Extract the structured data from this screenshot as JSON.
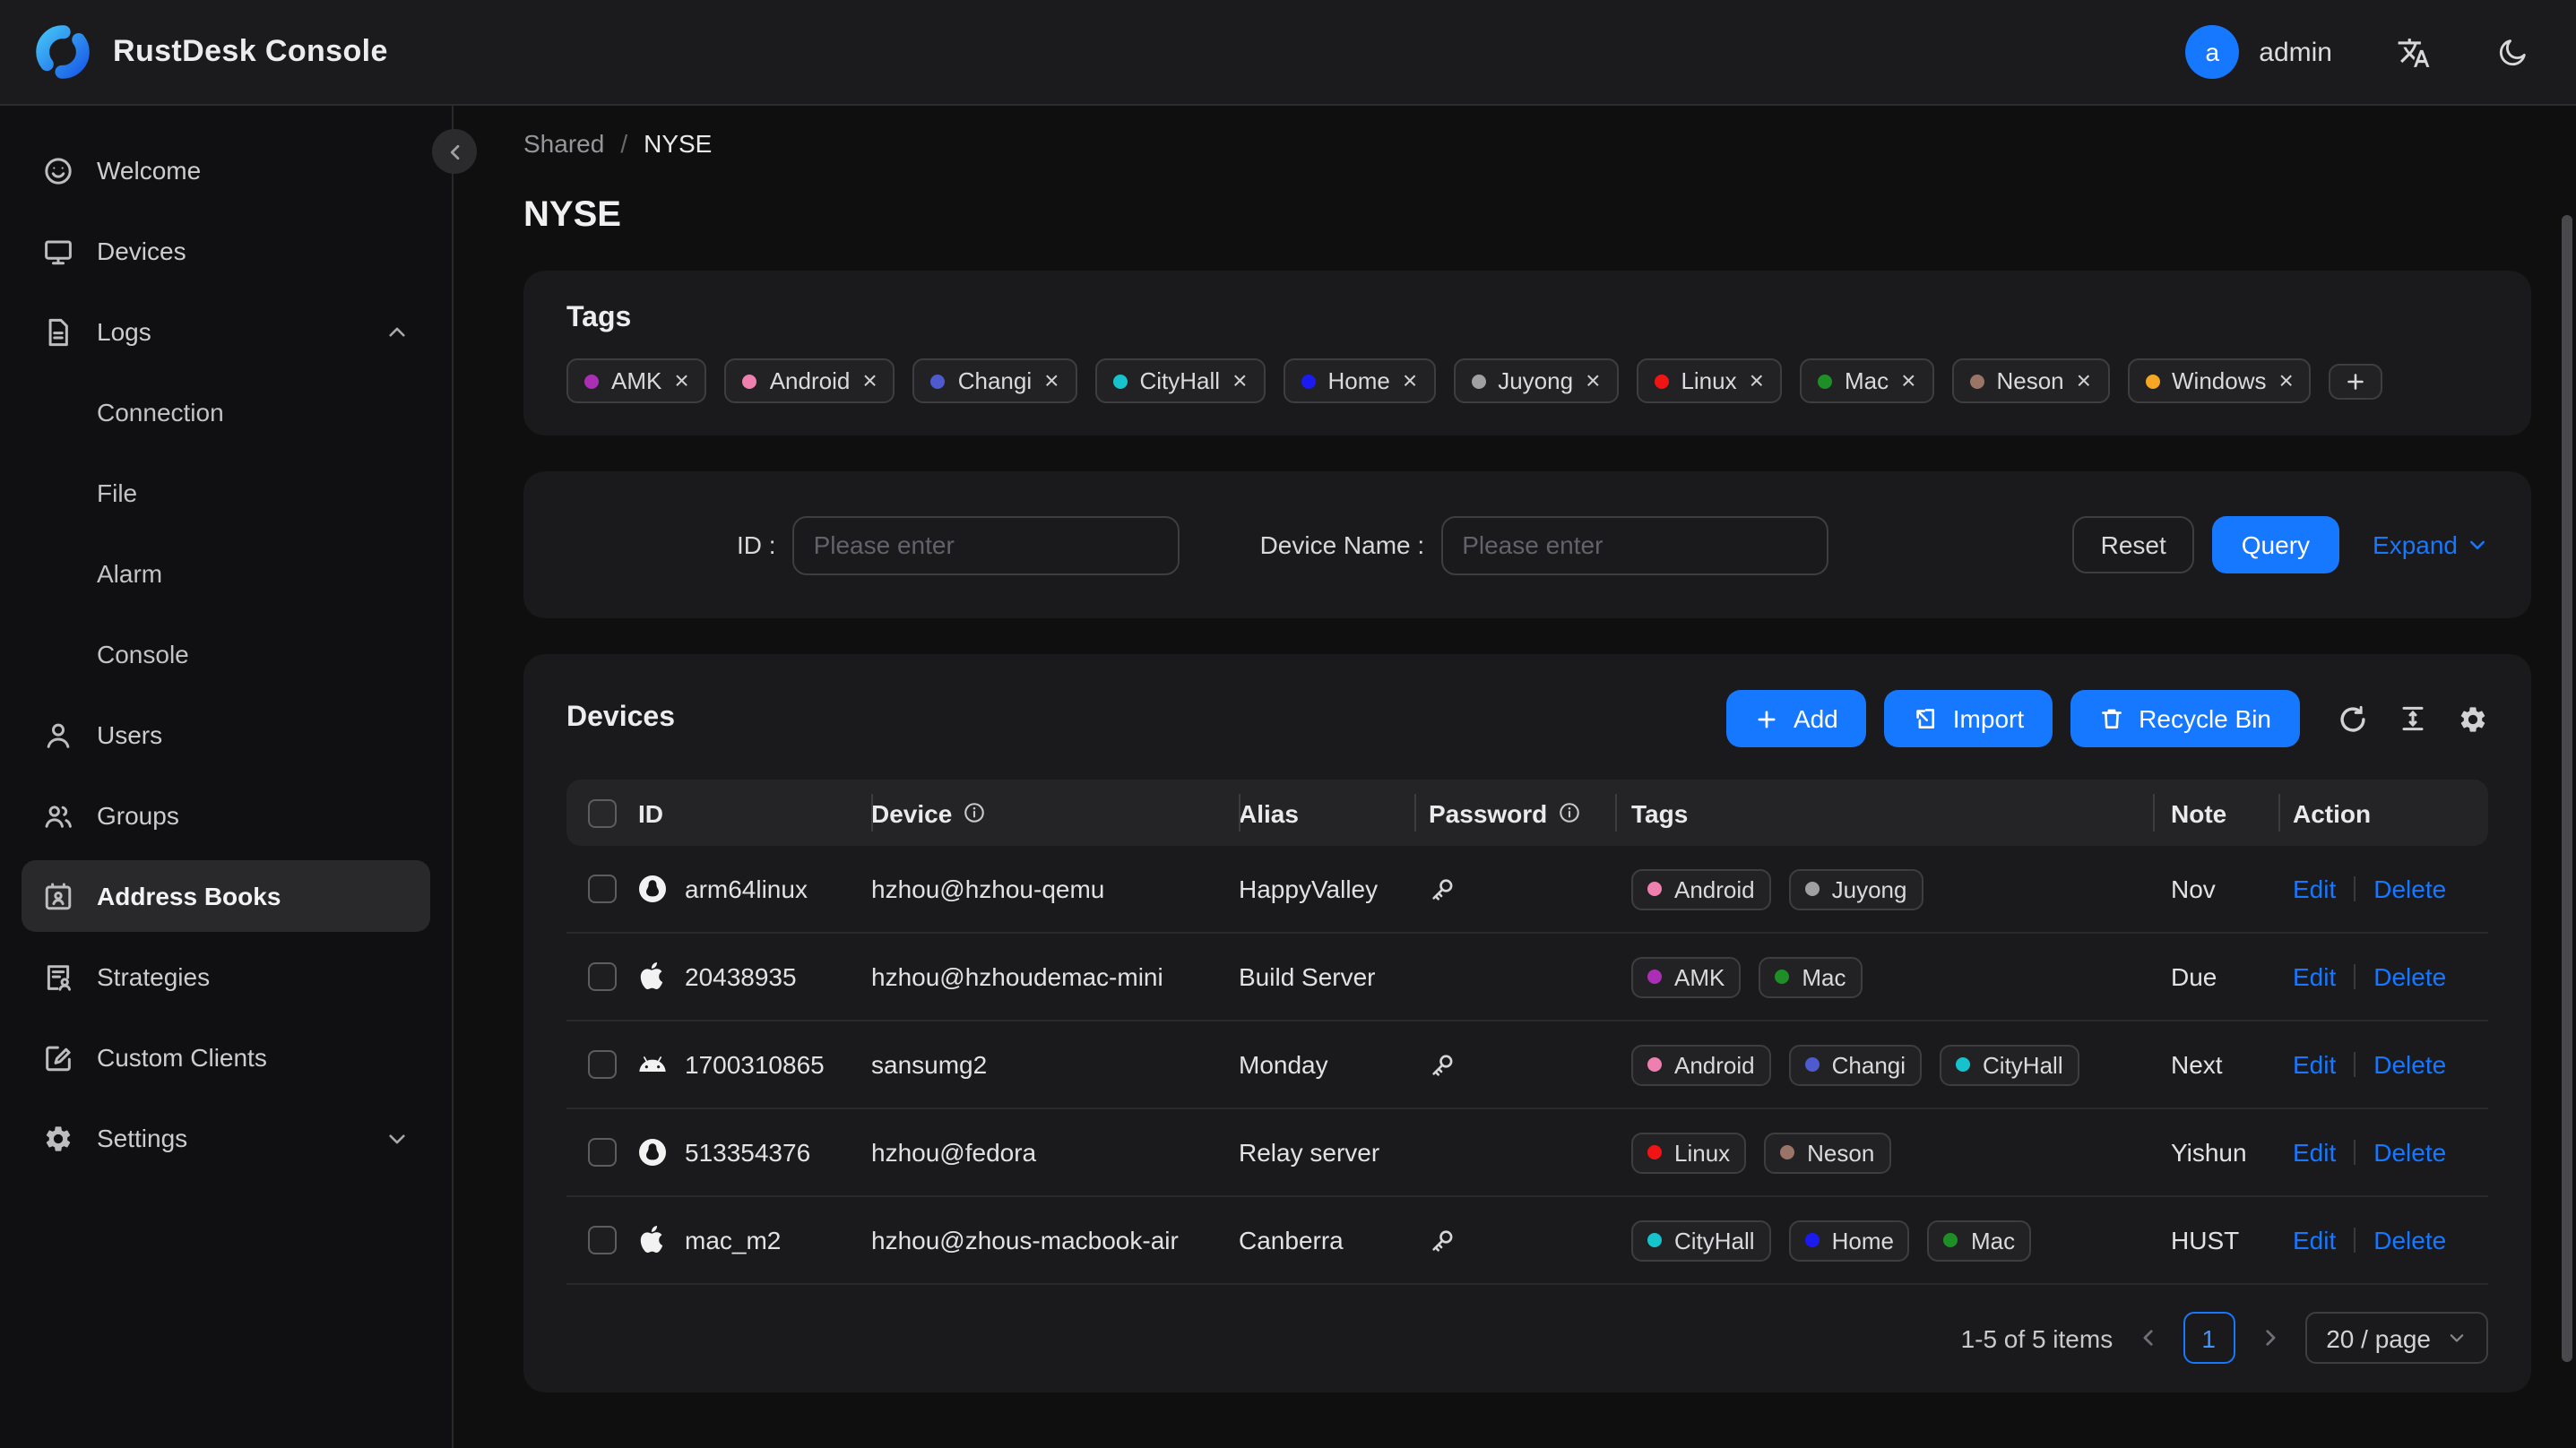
{
  "header": {
    "title": "RustDesk Console",
    "user": {
      "initial": "a",
      "name": "admin"
    }
  },
  "sidebar": {
    "items": [
      {
        "label": "Welcome",
        "icon": "smiley-icon"
      },
      {
        "label": "Devices",
        "icon": "monitor-icon"
      },
      {
        "label": "Logs",
        "icon": "document-icon",
        "expanded": true,
        "children": [
          "Connection",
          "File",
          "Alarm",
          "Console"
        ]
      },
      {
        "label": "Users",
        "icon": "user-icon"
      },
      {
        "label": "Groups",
        "icon": "group-icon"
      },
      {
        "label": "Address Books",
        "icon": "address-book-icon",
        "active": true
      },
      {
        "label": "Strategies",
        "icon": "strategy-icon"
      },
      {
        "label": "Custom Clients",
        "icon": "edit-square-icon"
      },
      {
        "label": "Settings",
        "icon": "gear-icon",
        "collapsed": true
      }
    ]
  },
  "breadcrumb": {
    "parent": "Shared",
    "current": "NYSE"
  },
  "page_title": "NYSE",
  "tags_card": {
    "title": "Tags",
    "tags": [
      {
        "name": "AMK",
        "color": "#ab2fb5"
      },
      {
        "name": "Android",
        "color": "#ef7fae"
      },
      {
        "name": "Changi",
        "color": "#4d5bce"
      },
      {
        "name": "CityHall",
        "color": "#16c2cc"
      },
      {
        "name": "Home",
        "color": "#1b1bf0"
      },
      {
        "name": "Juyong",
        "color": "#a0a0a2"
      },
      {
        "name": "Linux",
        "color": "#f01414"
      },
      {
        "name": "Mac",
        "color": "#1d8f26"
      },
      {
        "name": "Neson",
        "color": "#9b7468"
      },
      {
        "name": "Windows",
        "color": "#f5a623"
      }
    ]
  },
  "filter": {
    "id_label": "ID :",
    "device_name_label": "Device Name :",
    "id_placeholder": "Please enter",
    "device_name_placeholder": "Please enter",
    "reset_label": "Reset",
    "query_label": "Query",
    "expand_label": "Expand"
  },
  "devices_card": {
    "title": "Devices",
    "add_label": "Add",
    "import_label": "Import",
    "recycle_label": "Recycle Bin",
    "columns": [
      {
        "label": "ID",
        "info": false
      },
      {
        "label": "Device",
        "info": true
      },
      {
        "label": "Alias",
        "info": false
      },
      {
        "label": "Password",
        "info": true
      },
      {
        "label": "Tags",
        "info": false
      },
      {
        "label": "Note",
        "info": false
      },
      {
        "label": "Action",
        "info": false
      }
    ],
    "edit_label": "Edit",
    "delete_label": "Delete",
    "rows": [
      {
        "os": "linux",
        "id": "arm64linux",
        "device": "hzhou@hzhou-qemu",
        "alias": "HappyValley",
        "has_password": true,
        "tags": [
          "Android",
          "Juyong"
        ],
        "note": "Nov"
      },
      {
        "os": "apple",
        "id": "20438935",
        "device": "hzhou@hzhoudemac-mini",
        "alias": "Build Server",
        "has_password": false,
        "tags": [
          "AMK",
          "Mac"
        ],
        "note": "Due"
      },
      {
        "os": "android",
        "id": "1700310865",
        "device": "sansumg2",
        "alias": "Monday",
        "has_password": true,
        "tags": [
          "Android",
          "Changi",
          "CityHall"
        ],
        "note": "Next"
      },
      {
        "os": "linux",
        "id": "513354376",
        "device": "hzhou@fedora",
        "alias": "Relay server",
        "has_password": false,
        "tags": [
          "Linux",
          "Neson"
        ],
        "note": "Yishun"
      },
      {
        "os": "apple",
        "id": "mac_m2",
        "device": "hzhou@zhous-macbook-air",
        "alias": "Canberra",
        "has_password": true,
        "tags": [
          "CityHall",
          "Home",
          "Mac"
        ],
        "note": "HUST"
      }
    ],
    "pagination": {
      "summary": "1-5 of 5 items",
      "page": "1",
      "page_size": "20 / page"
    }
  },
  "colors": {
    "accent": "#1677ff"
  }
}
